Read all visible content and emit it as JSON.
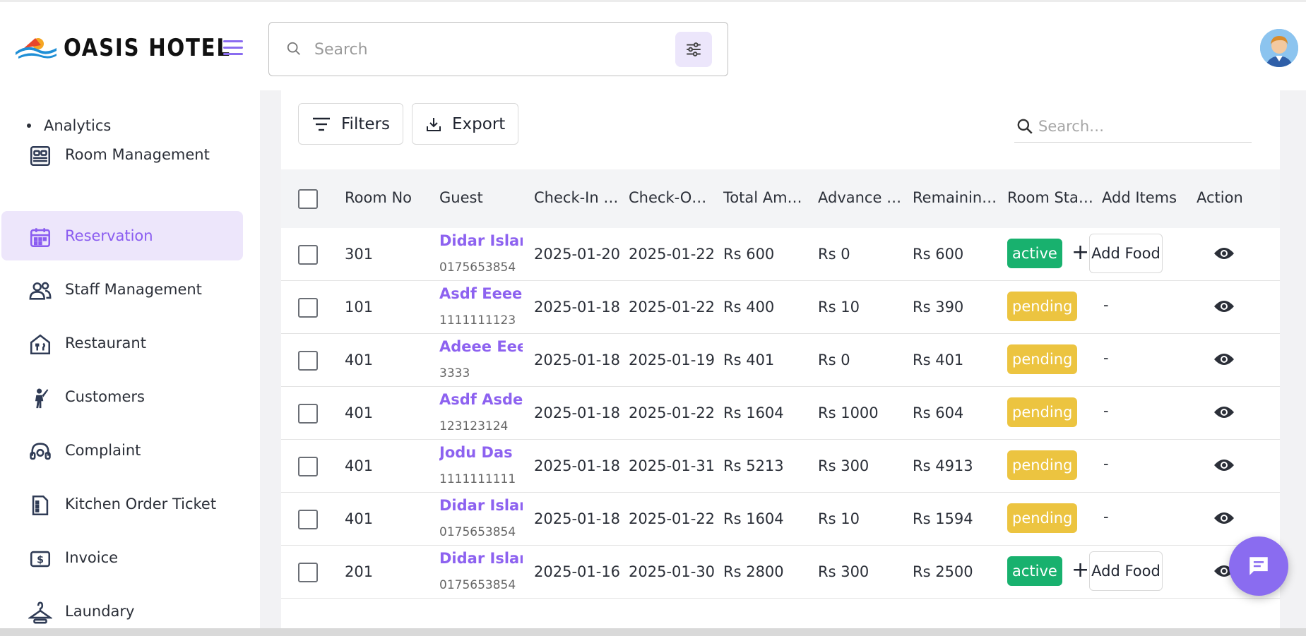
{
  "brand": {
    "title": "OASIS HOTEL"
  },
  "header": {
    "search_placeholder": "Search"
  },
  "sidebar": {
    "sub_item": "Analytics",
    "items": [
      {
        "label": "Room Management",
        "icon": "bed-icon"
      },
      {
        "label": "Reservation",
        "icon": "calendar-icon",
        "active": true
      },
      {
        "label": "Staff Management",
        "icon": "people-icon"
      },
      {
        "label": "Restaurant",
        "icon": "restaurant-icon"
      },
      {
        "label": "Customers",
        "icon": "person-waving-icon"
      },
      {
        "label": "Complaint",
        "icon": "headset-icon"
      },
      {
        "label": "Kitchen Order Ticket",
        "icon": "ticket-icon"
      },
      {
        "label": "Invoice",
        "icon": "invoice-dollar-icon"
      },
      {
        "label": "Laundary",
        "icon": "hanger-icon"
      }
    ]
  },
  "toolbar": {
    "filters_label": "Filters",
    "export_label": "Export",
    "search_placeholder": "Search…"
  },
  "table": {
    "columns": [
      "Room No",
      "Guest",
      "Check-In …",
      "Check-O…",
      "Total Am…",
      "Advance …",
      "Remainin…",
      "Room Sta…",
      "Add Items",
      "Action"
    ],
    "add_food_label": "Add Food",
    "rows": [
      {
        "room": "301",
        "guest": "Didar Islam",
        "phone": "0175653854",
        "checkin": "2025-01-20",
        "checkout": "2025-01-22",
        "total": "Rs 600",
        "advance": "Rs 0",
        "remaining": "Rs 600",
        "status": "active",
        "add_items": ""
      },
      {
        "room": "101",
        "guest": "Asdf Eeee",
        "phone": "1111111123",
        "checkin": "2025-01-18",
        "checkout": "2025-01-22",
        "total": "Rs 400",
        "advance": "Rs 10",
        "remaining": "Rs 390",
        "status": "pending",
        "add_items": "-"
      },
      {
        "room": "401",
        "guest": "Adeee Eeee",
        "phone": "3333",
        "checkin": "2025-01-18",
        "checkout": "2025-01-19",
        "total": "Rs 401",
        "advance": "Rs 0",
        "remaining": "Rs 401",
        "status": "pending",
        "add_items": "-"
      },
      {
        "room": "401",
        "guest": "Asdf Asdef",
        "phone": "123123124",
        "checkin": "2025-01-18",
        "checkout": "2025-01-22",
        "total": "Rs 1604",
        "advance": "Rs 1000",
        "remaining": "Rs 604",
        "status": "pending",
        "add_items": "-"
      },
      {
        "room": "401",
        "guest": "Jodu Das",
        "phone": "1111111111",
        "checkin": "2025-01-18",
        "checkout": "2025-01-31",
        "total": "Rs 5213",
        "advance": "Rs 300",
        "remaining": "Rs 4913",
        "status": "pending",
        "add_items": "-"
      },
      {
        "room": "401",
        "guest": "Didar Islam",
        "phone": "0175653854",
        "checkin": "2025-01-18",
        "checkout": "2025-01-22",
        "total": "Rs 1604",
        "advance": "Rs 10",
        "remaining": "Rs 1594",
        "status": "pending",
        "add_items": "-"
      },
      {
        "room": "201",
        "guest": "Didar Islam",
        "phone": "0175653854",
        "checkin": "2025-01-16",
        "checkout": "2025-01-30",
        "total": "Rs 2800",
        "advance": "Rs 300",
        "remaining": "Rs 2500",
        "status": "active",
        "add_items": ""
      }
    ]
  },
  "colors": {
    "accent": "#8a6cf0",
    "active": "#18b16e",
    "pending": "#ecc440"
  }
}
